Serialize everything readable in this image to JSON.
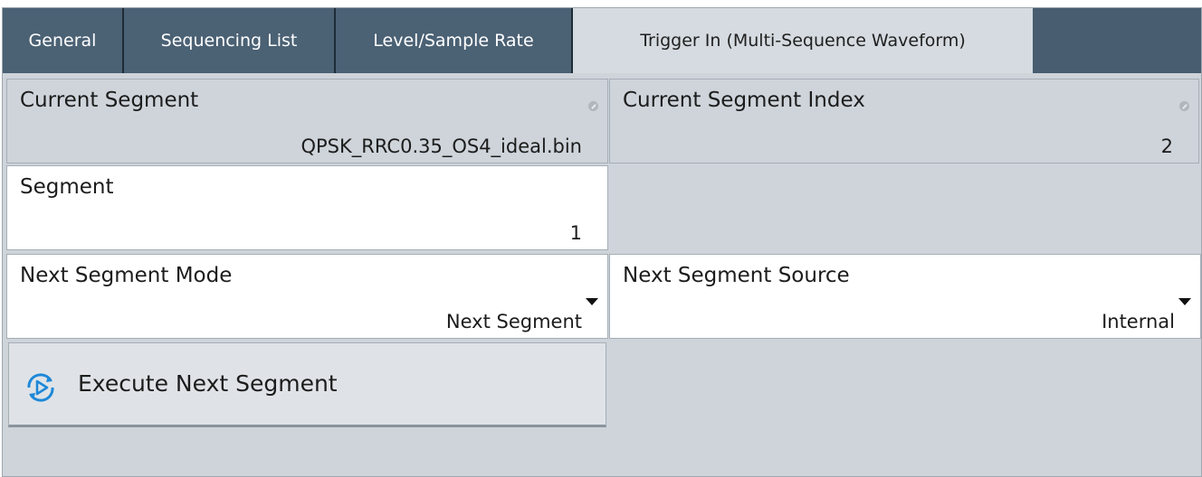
{
  "tabs": [
    {
      "label": "General",
      "active": false
    },
    {
      "label": "Sequencing List",
      "active": false
    },
    {
      "label": "Level/Sample Rate",
      "active": false
    },
    {
      "label": "Trigger In (Multi-Sequence Waveform)",
      "active": true
    }
  ],
  "fields": {
    "current_segment": {
      "label": "Current Segment",
      "value": "QPSK_RRC0.35_OS4_ideal.bin",
      "editable": false
    },
    "current_segment_index": {
      "label": "Current Segment Index",
      "value": "2",
      "editable": false
    },
    "segment": {
      "label": "Segment",
      "value": "1",
      "editable": true
    },
    "next_segment_mode": {
      "label": "Next Segment Mode",
      "value": "Next Segment",
      "type": "dropdown"
    },
    "next_segment_source": {
      "label": "Next Segment Source",
      "value": "Internal",
      "type": "dropdown"
    }
  },
  "actions": {
    "execute_next_segment": {
      "label": "Execute Next Segment",
      "icon": "execute-play-icon"
    }
  },
  "colors": {
    "tab_bar": "#485d6f",
    "active_tab": "#d5dbe0",
    "readonly_cell": "#ced4da",
    "editable_cell": "#ffffff",
    "icon_accent": "#1e88d8"
  }
}
